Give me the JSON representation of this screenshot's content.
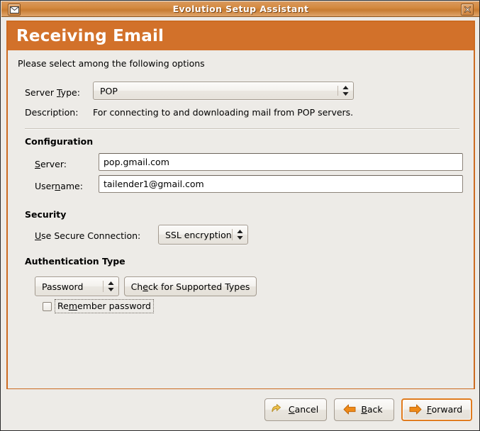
{
  "window": {
    "title": "Evolution Setup Assistant",
    "app_icon": "envelope-icon",
    "close_icon": "close-icon"
  },
  "banner": {
    "title": "Receiving Email",
    "color": "#d2712a"
  },
  "form": {
    "intro": "Please select among the following options",
    "server_type": {
      "label_pre": "Server ",
      "label_mnemonic": "T",
      "label_post": "ype:",
      "value": "POP"
    },
    "description": {
      "label": "Description:",
      "value": "For connecting to and downloading mail from POP servers."
    },
    "configuration": {
      "heading": "Configuration",
      "server": {
        "label_mnemonic": "S",
        "label_post": "erver:",
        "value": "pop.gmail.com",
        "placeholder": ""
      },
      "username": {
        "label_pre": "User",
        "label_mnemonic": "n",
        "label_post": "ame:",
        "value": "tailender1@gmail.com",
        "placeholder": ""
      }
    },
    "security": {
      "heading": "Security",
      "secure_connection": {
        "label_mnemonic": "U",
        "label_post": "se Secure Connection:",
        "value": "SSL encryption"
      }
    },
    "authentication": {
      "heading": "Authentication Type",
      "auth_type": {
        "value": "Password"
      },
      "check_button": {
        "label_pre": "Ch",
        "label_mnemonic": "e",
        "label_post": "ck for Supported Types"
      },
      "remember_password": {
        "label_pre": "Re",
        "label_mnemonic": "m",
        "label_post": "ember password",
        "checked": false
      }
    }
  },
  "actions": {
    "cancel": {
      "label_pre": "",
      "label_mnemonic": "C",
      "label_post": "ancel",
      "icon": "undo-arrow-icon"
    },
    "back": {
      "label_pre": "",
      "label_mnemonic": "B",
      "label_post": "ack",
      "icon": "arrow-left-icon"
    },
    "forward": {
      "label_pre": "",
      "label_mnemonic": "F",
      "label_post": "orward",
      "icon": "arrow-right-icon",
      "focused": true
    }
  }
}
